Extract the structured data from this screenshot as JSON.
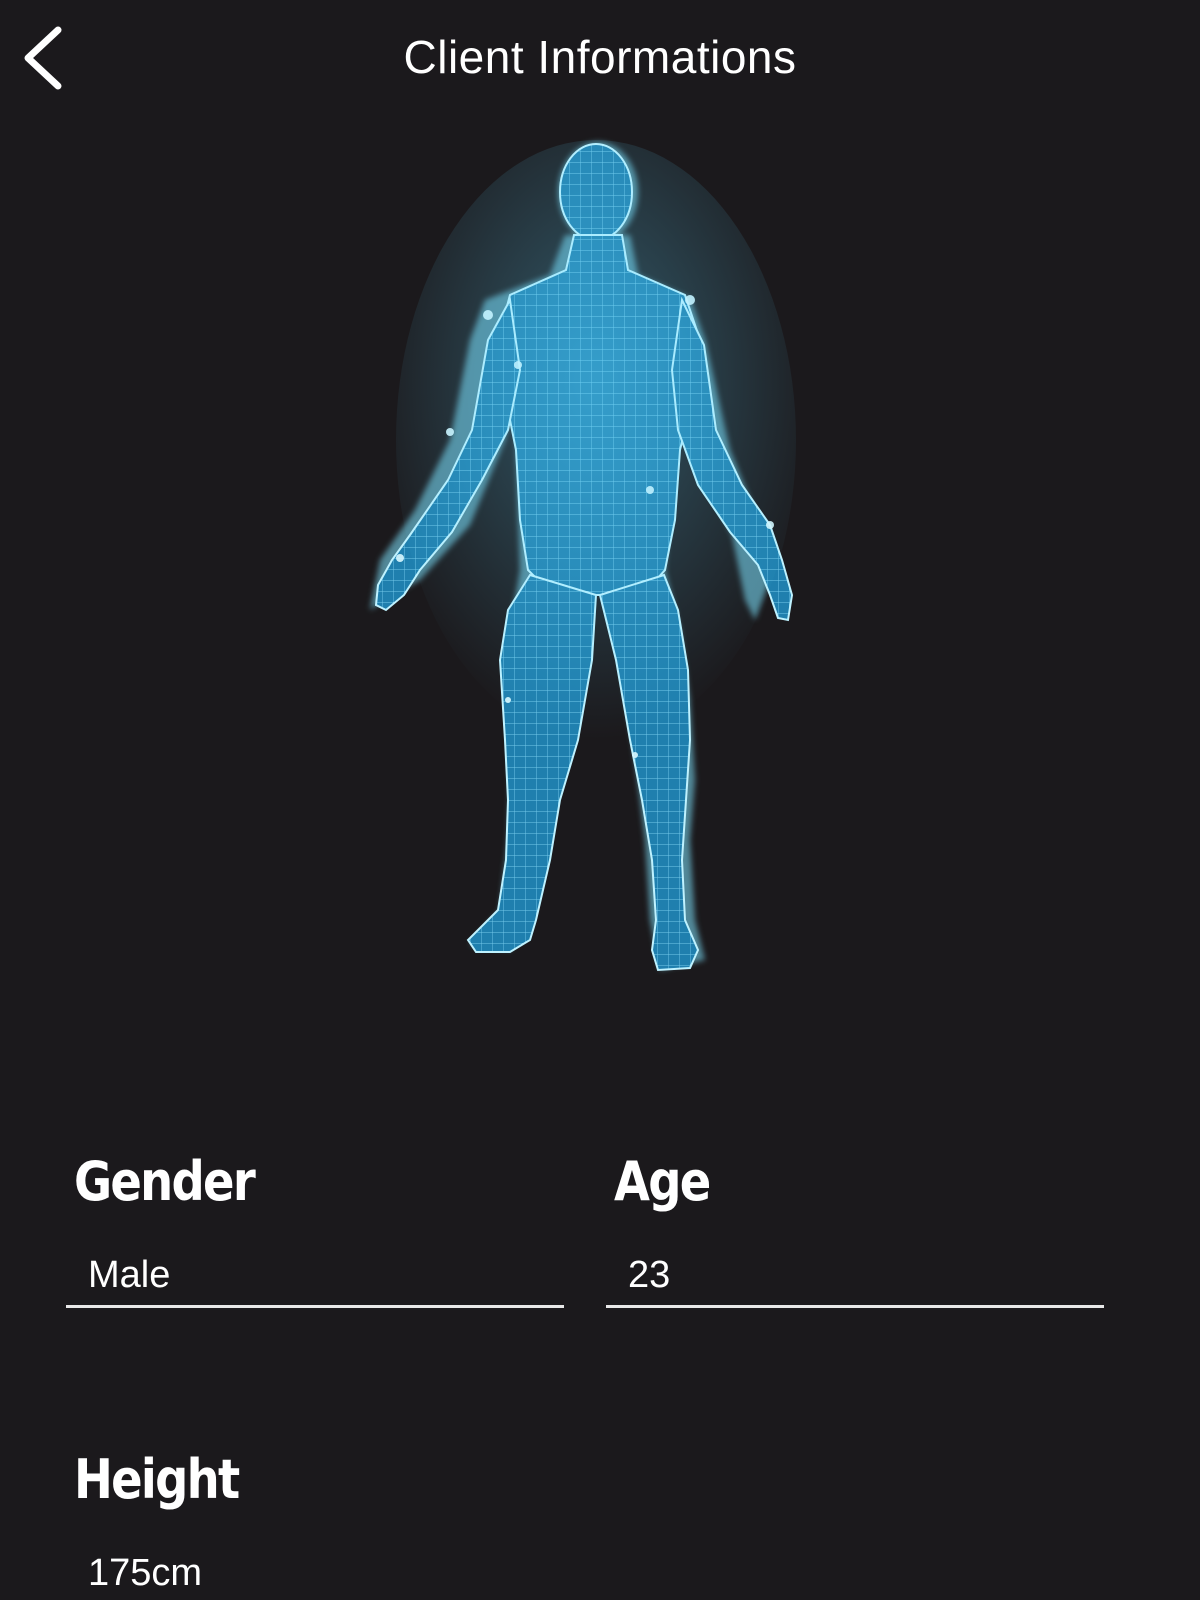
{
  "header": {
    "title": "Client Informations",
    "back_icon": "chevron-left-icon"
  },
  "body_model": {
    "icon": "human-wireframe-model",
    "color": "#2fb4e6"
  },
  "fields": {
    "gender": {
      "label": "Gender",
      "value": "Male"
    },
    "age": {
      "label": "Age",
      "value": "23"
    },
    "height": {
      "label": "Height",
      "value": "175cm"
    }
  },
  "colors": {
    "background": "#1b191c",
    "text": "#ffffff",
    "accent": "#2fb4e6"
  }
}
